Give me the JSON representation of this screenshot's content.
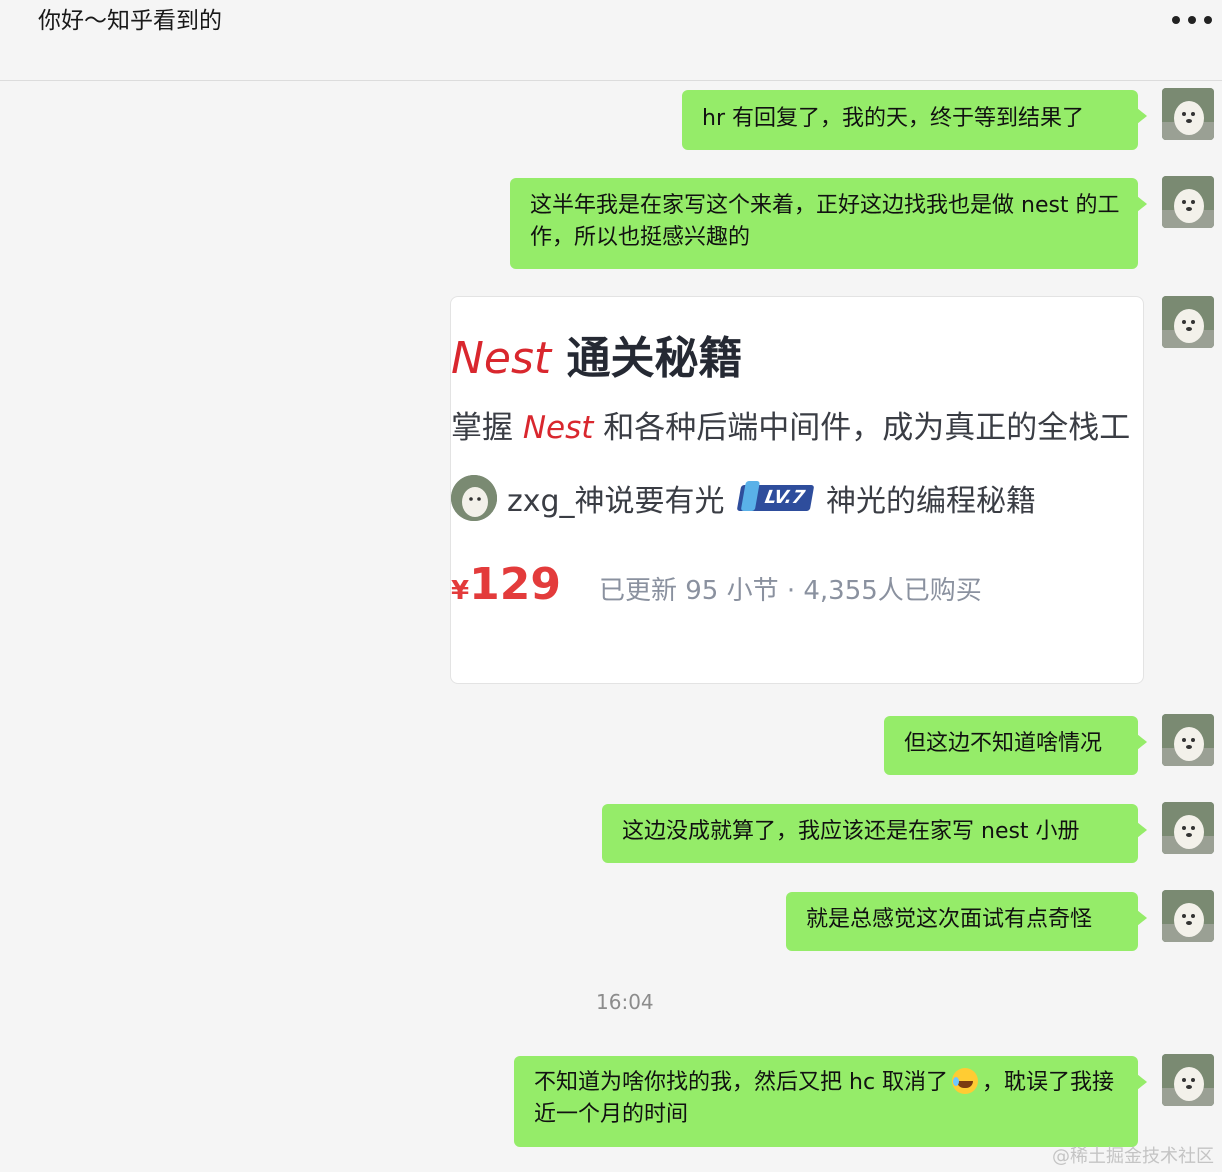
{
  "header": {
    "title": "你好～知乎看到的",
    "more_icon": "more-horizontal-icon"
  },
  "messages": [
    {
      "text": "hr 有回复了，我的天，终于等到结果了"
    },
    {
      "text": "这半年我是在家写这个来着，正好这边找我也是做 nest 的工作，所以也挺感兴趣的"
    },
    {
      "text": "但这边不知道啥情况"
    },
    {
      "text": "这边没成就算了，我应该还是在家写 nest 小册"
    },
    {
      "text": "就是总感觉这次面试有点奇怪"
    },
    {
      "text_before": "不知道为啥你找的我，然后又把 hc 取消了",
      "emoji": "laughing-tears-icon",
      "text_after": "，耽误了我接近一个月的时间"
    }
  ],
  "card": {
    "title_brand": "Nest",
    "title_rest": "通关秘籍",
    "subtitle_pre": "掌握",
    "subtitle_brand": "Nest",
    "subtitle_post": "和各种后端中间件，成为真正的全栈工",
    "author": "zxg_神说要有光",
    "level": "LV.7",
    "column": "神光的编程秘籍",
    "price_symbol": "¥",
    "price": "129",
    "meta": "已更新 95 小节 · 4,355人已购买"
  },
  "timestamp": "16:04",
  "watermark": "@稀土掘金技术社区",
  "colors": {
    "bubble": "#95ec69",
    "background": "#f5f5f5",
    "brand_red": "#d9272e",
    "price_red": "#e33b3b"
  }
}
